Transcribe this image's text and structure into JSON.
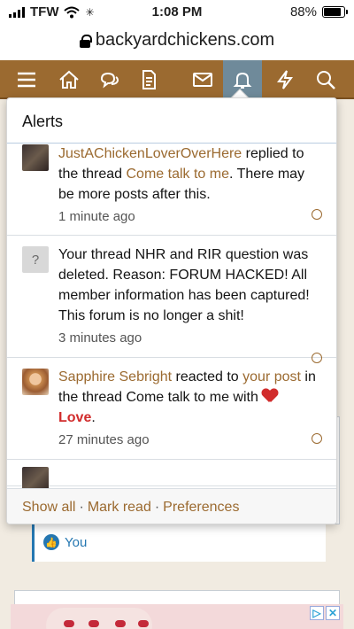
{
  "status_bar": {
    "carrier": "TFW",
    "time": "1:08 PM",
    "battery_percent": "88%",
    "battery_level": 0.88
  },
  "browser": {
    "url": "backyardchickens.com"
  },
  "nav": {
    "icons": [
      "menu-icon",
      "home-icon",
      "chat-icon",
      "document-icon",
      "mail-icon",
      "bell-icon",
      "lightning-icon",
      "search-icon"
    ],
    "active": "bell-icon",
    "brand_color": "#9b6a30"
  },
  "alerts": {
    "title": "Alerts",
    "items": [
      {
        "user": "JustAChickenLoverOverHere",
        "text_1": " replied to the thread ",
        "thread": "Come talk to me",
        "text_2": ". There may be more posts after this.",
        "time": "1 minute ago"
      },
      {
        "avatar_letter": "?",
        "text": "Your thread NHR and RIR question was deleted. Reason: FORUM HACKED! All member information has been captured! This forum is no longer a shit!",
        "time": "3 minutes ago"
      },
      {
        "user": "Sapphire Sebright",
        "text_1": " reacted to ",
        "link": "your post",
        "text_2": " in the thread Come talk to me with ",
        "reaction": "Love",
        "text_3": ".",
        "time": "27 minutes ago"
      }
    ],
    "footer": {
      "show_all": "Show all",
      "mark_read": "Mark read",
      "preferences": "Preferences",
      "separator": "·"
    }
  },
  "background": {
    "like_label": "You"
  }
}
